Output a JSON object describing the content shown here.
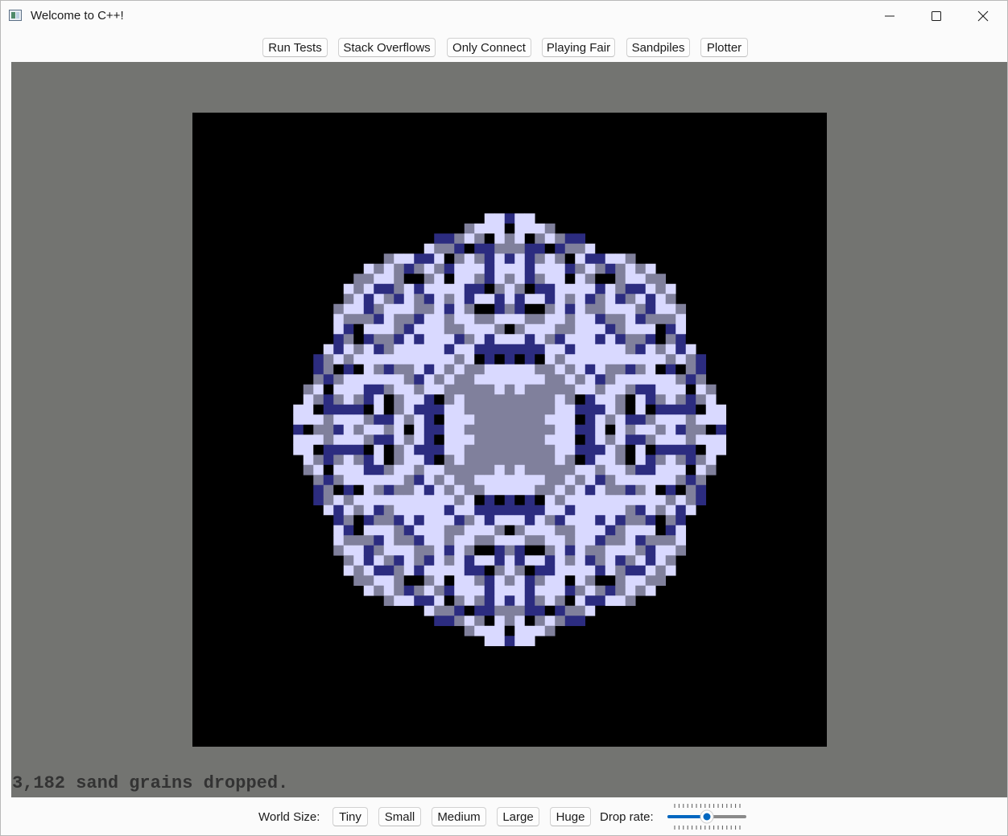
{
  "window": {
    "title": "Welcome to C++!",
    "controls": {
      "minimize": "minimize-icon",
      "maximize": "maximize-icon",
      "close": "close-icon"
    }
  },
  "top_toolbar": {
    "buttons": [
      "Run Tests",
      "Stack Overflows",
      "Only Connect",
      "Playing Fair",
      "Sandpiles",
      "Plotter"
    ]
  },
  "status": {
    "text": "3,182 sand grains dropped."
  },
  "bottom_toolbar": {
    "world_size_label": "World Size:",
    "sizes": [
      "Tiny",
      "Small",
      "Medium",
      "Large",
      "Huge"
    ],
    "drop_rate_label": "Drop rate:",
    "drop_rate_value": 0.5
  },
  "colors": {
    "stage_background": "#737471",
    "board_background": "#000000",
    "grains_0": "#000000",
    "grains_1": "#2c2c80",
    "grains_2": "#80809c",
    "grains_3": "#d9d9ff",
    "accent": "#0067c0"
  },
  "sandpile": {
    "grains_dropped": 3182,
    "levels": "0 = black, 1 = dark blue, 2 = grey-blue, 3 = pale lavender"
  }
}
